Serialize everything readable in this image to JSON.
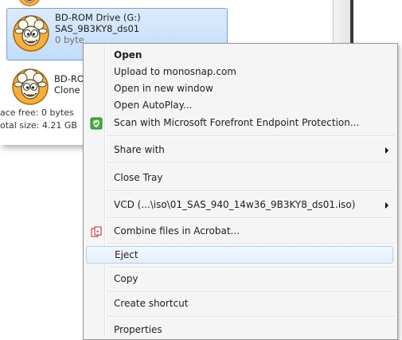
{
  "explorer": {
    "drives": [
      {
        "name": "BD-ROM Drive (G:)",
        "volume": "SAS_9B3KY8_ds01",
        "detail": "0 byte"
      },
      {
        "name": "BD-RO",
        "volume": "Clone"
      }
    ],
    "status": {
      "space_free": "ace free: 0 bytes",
      "total_size": "otal size: 4.21 GB"
    }
  },
  "context_menu": {
    "items": [
      {
        "label": "Open",
        "bold": true
      },
      {
        "label": "Upload to monosnap.com"
      },
      {
        "label": "Open in new window"
      },
      {
        "label": "Open AutoPlay..."
      },
      {
        "label": "Scan with Microsoft Forefront Endpoint Protection...",
        "icon": "forefront-shield-icon"
      },
      {
        "label": "Share with",
        "submenu": true
      },
      {
        "label": "Close Tray"
      },
      {
        "label": "VCD (...\\iso\\01_SAS_940_14w36_9B3KY8_ds01.iso)",
        "submenu": true
      },
      {
        "label": "Combine files in Acrobat...",
        "icon": "acrobat-icon"
      },
      {
        "label": "Eject",
        "highlighted": true
      },
      {
        "label": "Copy"
      },
      {
        "label": "Create shortcut"
      },
      {
        "label": "Properties"
      }
    ]
  },
  "colors": {
    "selection_fill": "#c1dcfc",
    "selection_border": "#7da2ce",
    "menu_background": "#f5f5f5",
    "hover_border": "#aecff7",
    "sheep_orange": "#f5a623"
  }
}
